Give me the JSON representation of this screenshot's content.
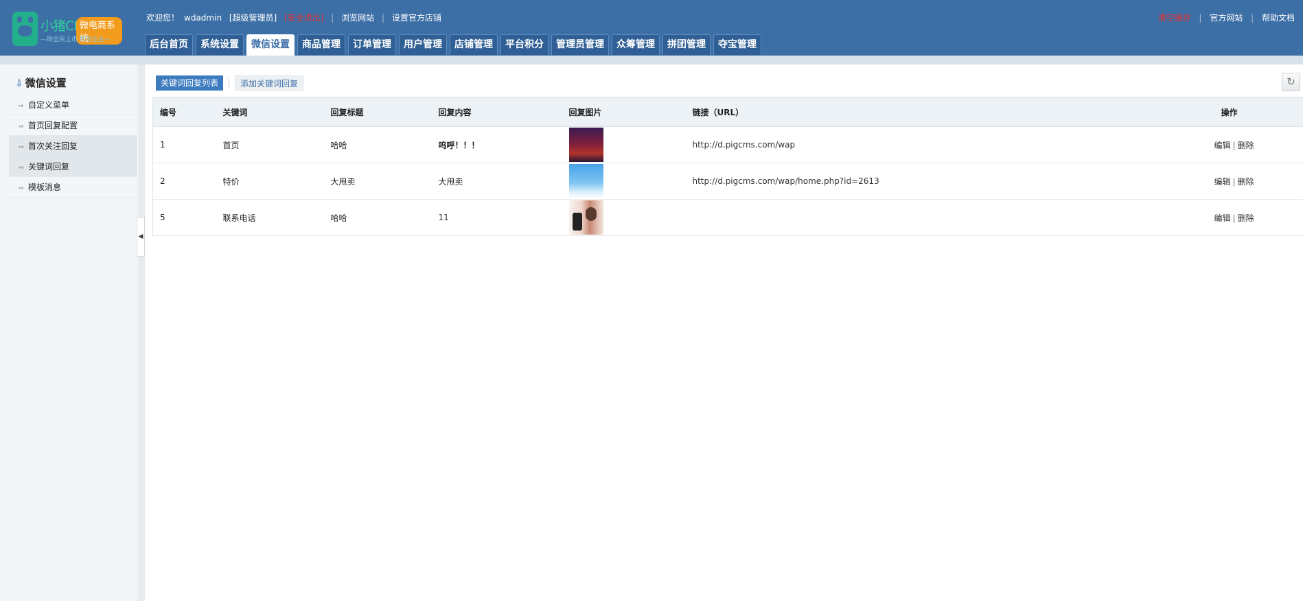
{
  "logo": {
    "brand": "小猪CMS",
    "tag": "微电商系统",
    "slogan": "—助全民上市 帮助企业—"
  },
  "topbar": {
    "welcome": "欢迎您！",
    "user": "wdadmin",
    "role": "[超级管理员]",
    "logout": "[安全退出]",
    "browse": "浏览网站",
    "store": "设置官方店铺"
  },
  "topright": {
    "clear_cache": "清空缓存",
    "official": "官方网站",
    "help": "帮助文档"
  },
  "nav": {
    "tabs": [
      "后台首页",
      "系统设置",
      "微信设置",
      "商品管理",
      "订单管理",
      "用户管理",
      "店铺管理",
      "平台积分",
      "管理员管理",
      "众筹管理",
      "拼团管理",
      "夺宝管理"
    ],
    "active": "微信设置"
  },
  "sidebar": {
    "title": "微信设置",
    "items": [
      {
        "label": "自定义菜单"
      },
      {
        "label": "首页回复配置"
      },
      {
        "label": "首次关注回复"
      },
      {
        "label": "关键词回复"
      },
      {
        "label": "模板消息"
      }
    ]
  },
  "main": {
    "tab_list": "关键词回复列表",
    "tab_add": "添加关键词回复",
    "refresh_icon": "refresh-icon"
  },
  "table": {
    "headers": {
      "id": "编号",
      "keyword": "关键词",
      "title": "回复标题",
      "content": "回复内容",
      "image": "回复图片",
      "link": "链接（URL）",
      "ops": "操作"
    },
    "rows": [
      {
        "id": "1",
        "keyword": "首页",
        "title": "哈哈",
        "content": "呜呼！！！",
        "link": "http://d.pigcms.com/wap",
        "edit": "编辑",
        "delete": "删除"
      },
      {
        "id": "2",
        "keyword": "特价",
        "title": "大甩卖",
        "content": "大甩卖",
        "link": "http://d.pigcms.com/wap/home.php?id=2613",
        "edit": "编辑",
        "delete": "删除"
      },
      {
        "id": "5",
        "keyword": "联系电话",
        "title": "哈哈",
        "content": "11",
        "link": "",
        "edit": "编辑",
        "delete": "删除"
      }
    ]
  }
}
